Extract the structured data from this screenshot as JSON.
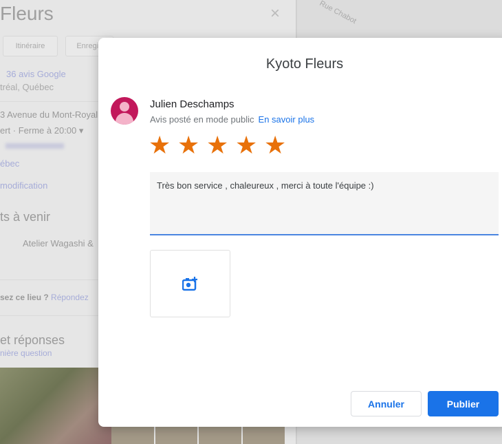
{
  "background": {
    "place_title": "Fleurs",
    "buttons": [
      "Itinéraire",
      "Enregis"
    ],
    "reviews_link": "36 avis Google",
    "city": "tréal, Québec",
    "address": "3 Avenue du Mont-Royal",
    "hours": "ert · Ferme à 20:00 ▾",
    "region": "ébec",
    "edit_link": "modification",
    "events_heading": "ts à venir",
    "event_item": "Atelier Wagashi &",
    "question_prompt": "sez ce lieu ?",
    "question_link": "Répondez",
    "qa_heading": "et réponses",
    "qa_link": "nière question",
    "map_street": "Rue Chabot",
    "close_symbol": "×"
  },
  "modal": {
    "title": "Kyoto Fleurs",
    "user_name": "Julien Deschamps",
    "visibility_note": "Avis posté en mode public",
    "learn_more": "En savoir plus",
    "rating": 5,
    "rating_max": 5,
    "review_text": "Très bon service , chaleureux , merci à toute l'équipe :)",
    "cancel_label": "Annuler",
    "publish_label": "Publier",
    "accent": "#1a73e8",
    "star_color": "#e8710a"
  }
}
